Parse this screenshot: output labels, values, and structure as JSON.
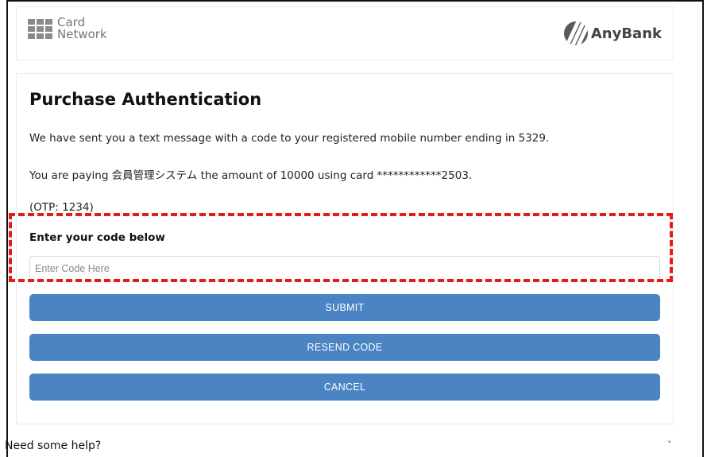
{
  "header": {
    "card_network_logo": [
      "Card",
      "Network"
    ],
    "bank_logo_text": "AnyBank"
  },
  "main": {
    "title": "Purchase Authentication",
    "message_sent": "We have sent you a text message with a code to your registered mobile number ending in 5329.",
    "payment_info": "You are paying 会員管理システム the amount of 10000 using card ************2503.",
    "otp_hint": "(OTP: 1234)",
    "code_label": "Enter your code below",
    "code_input": {
      "value": "",
      "placeholder": "Enter Code Here"
    },
    "buttons": {
      "submit": "SUBMIT",
      "resend": "RESEND CODE",
      "cancel": "CANCEL"
    }
  },
  "footer": {
    "help_text": "Need some help?",
    "toggle_glyph": "˅"
  },
  "colors": {
    "button_bg": "#4a84c2",
    "highlight": "#e31b1b"
  },
  "icons": [
    "card-network-logo-icon",
    "anybank-logo-icon",
    "chevron-down-icon"
  ]
}
